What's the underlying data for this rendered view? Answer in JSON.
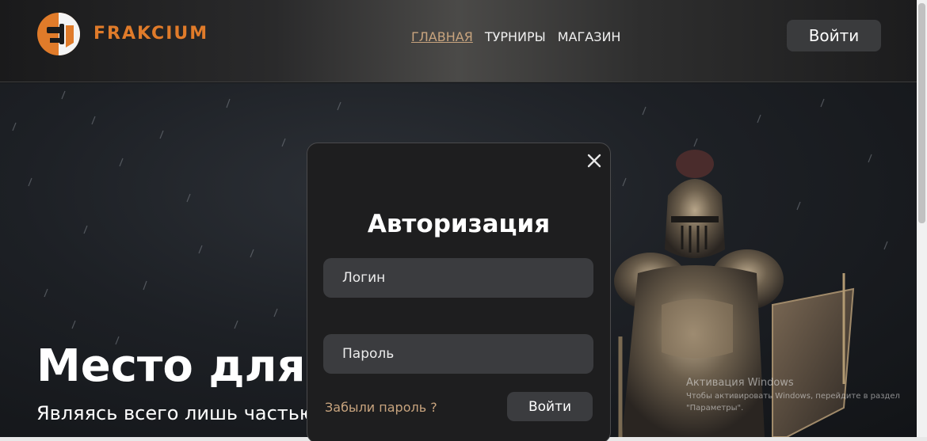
{
  "header": {
    "logo_text": "FRAKCIUM",
    "nav": [
      {
        "label": "ГЛАВНАЯ",
        "active": true
      },
      {
        "label": "ТУРНИРЫ",
        "active": false
      },
      {
        "label": "МАГАЗИН",
        "active": false
      }
    ],
    "login_button": "Войти"
  },
  "hero": {
    "title": "Место для за",
    "subtitle": "Являясь всего лишь частью"
  },
  "modal": {
    "title": "Авторизация",
    "login_placeholder": "Логин",
    "password_placeholder": "Пароль",
    "forgot_link": "Забыли пароль ?",
    "submit_button": "Войти",
    "close_icon": "close-icon"
  },
  "watermark": {
    "title": "Активация Windows",
    "text": "Чтобы активировать Windows, перейдите в раздел \"Параметры\"."
  },
  "colors": {
    "accent": "#c8a47e",
    "logo": "#e07b2a",
    "modal_bg": "#1e1e1f",
    "field_bg": "#3b3c3f"
  }
}
